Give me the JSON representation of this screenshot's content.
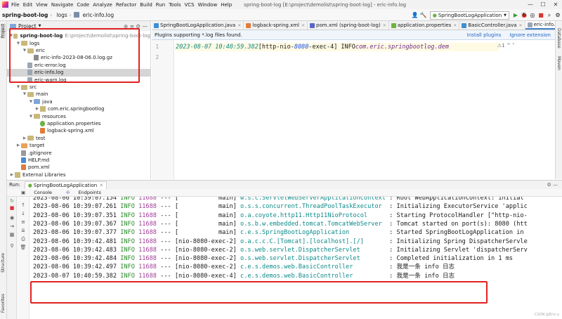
{
  "menu": {
    "items": [
      "File",
      "Edit",
      "View",
      "Navigate",
      "Code",
      "Analyze",
      "Refactor",
      "Build",
      "Run",
      "Tools",
      "VCS",
      "Window",
      "Help"
    ],
    "window_title": "spring-boot-log [E:\\project\\demolist\\spring-boot-log] - eric-info.log"
  },
  "nav": {
    "crumbs": [
      "spring-boot-log",
      "logs",
      "eric-info.log"
    ],
    "run_config": "SpringBootLogApplication"
  },
  "stripes": {
    "left": [
      "Project",
      "Structure",
      "Favorites"
    ],
    "right": [
      "Database",
      "Maven"
    ]
  },
  "project": {
    "header": "Project",
    "tree": [
      {
        "label": "spring-boot-log",
        "extra": "E:\\project\\demolist\\spring-boot-log",
        "indent": 0,
        "arrow": "v",
        "icon": "fold",
        "bold": true
      },
      {
        "label": "logs",
        "indent": 1,
        "arrow": "v",
        "icon": "fold"
      },
      {
        "label": "eric",
        "indent": 2,
        "arrow": "v",
        "icon": "fold"
      },
      {
        "label": "eric-info-2023-08-06.0.log.gz",
        "indent": 3,
        "arrow": "",
        "icon": "gz"
      },
      {
        "label": "eric-error.log",
        "indent": 2,
        "arrow": "",
        "icon": "file"
      },
      {
        "label": "eric-info.log",
        "indent": 2,
        "arrow": "",
        "icon": "file",
        "selected": true
      },
      {
        "label": "eric-warn.log",
        "indent": 2,
        "arrow": "",
        "icon": "file"
      },
      {
        "label": "src",
        "indent": 1,
        "arrow": "v",
        "icon": "fold"
      },
      {
        "label": "main",
        "indent": 2,
        "arrow": "v",
        "icon": "fold"
      },
      {
        "label": "java",
        "indent": 3,
        "arrow": "v",
        "icon": "blue"
      },
      {
        "label": "com.eric.springbootlog",
        "indent": 4,
        "arrow": ">",
        "icon": "pkg"
      },
      {
        "label": "resources",
        "indent": 3,
        "arrow": "v",
        "icon": "fold"
      },
      {
        "label": "application.properties",
        "indent": 4,
        "arrow": "",
        "icon": "spring"
      },
      {
        "label": "logback-spring.xml",
        "indent": 4,
        "arrow": "",
        "icon": "xml"
      },
      {
        "label": "test",
        "indent": 2,
        "arrow": ">",
        "icon": "fold"
      },
      {
        "label": "target",
        "indent": 1,
        "arrow": ">",
        "icon": "orange"
      },
      {
        "label": ".gitignore",
        "indent": 1,
        "arrow": "",
        "icon": "git"
      },
      {
        "label": "HELP.md",
        "indent": 1,
        "arrow": "",
        "icon": "md"
      },
      {
        "label": "pom.xml",
        "indent": 1,
        "arrow": "",
        "icon": "xml"
      },
      {
        "label": "External Libraries",
        "indent": 0,
        "arrow": ">",
        "icon": "pkg"
      }
    ]
  },
  "editor": {
    "tabs": [
      {
        "label": "SpringBootLogApplication.java",
        "color": "#3f8fd2"
      },
      {
        "label": "logback-spring.xml",
        "color": "#e07b3c"
      },
      {
        "label": "pom.xml (spring-boot-log)",
        "color": "#5865c9"
      },
      {
        "label": "application.properties",
        "color": "#6db33f"
      },
      {
        "label": "BasicController.java",
        "color": "#3f8fd2"
      },
      {
        "label": "eric-info.log",
        "color": "#9aa7b4",
        "active": true
      }
    ],
    "notice": "Plugins supporting *.log files found.",
    "notice_install": "Install plugins",
    "notice_ignore": "Ignore extension",
    "line_numbers": [
      "1",
      "2"
    ],
    "line1": {
      "ts": "2023-08-07 10:40:59.382",
      "thread_pre": " [http-nio-",
      "port": "8080",
      "thread_post": "-exec-4] INFO  ",
      "cls": "com.eric.springbootlog.dem"
    },
    "meta": "⚠1 ^ ˅"
  },
  "run": {
    "label": "Run:",
    "tab": "SpringBootLogApplication",
    "subtabs": [
      "Console",
      "Endpoints"
    ],
    "lines": [
      {
        "ts": "2023-08-06 10:39:07.154",
        "thread": "[           main]",
        "logger": "w.s.c.ServletWebServerApplicationContext",
        "msg": ": Root WebApplicationContext: initial"
      },
      {
        "ts": "2023-08-06 10:39:07.261",
        "thread": "[           main]",
        "logger": "o.s.s.concurrent.ThreadPoolTaskExecutor ",
        "msg": ": Initializing ExecutorService 'applic"
      },
      {
        "ts": "2023-08-06 10:39:07.351",
        "thread": "[           main]",
        "logger": "o.a.coyote.http11.Http11NioProtocol     ",
        "msg": ": Starting ProtocolHandler [\"http-nio-"
      },
      {
        "ts": "2023-08-06 10:39:07.367",
        "thread": "[           main]",
        "logger": "o.s.b.w.embedded.tomcat.TomcatWebServer ",
        "msg": ": Tomcat started on port(s): 8080 (htt"
      },
      {
        "ts": "2023-08-06 10:39:07.377",
        "thread": "[           main]",
        "logger": "c.e.s.SpringBootLogApplication          ",
        "msg": ": Started SpringBootLogApplication in "
      },
      {
        "ts": "2023-08-06 10:39:42.481",
        "thread": "[nio-8080-exec-2]",
        "logger": "o.a.c.c.C.[Tomcat].[localhost].[/]      ",
        "msg": ": Initializing Spring DispatcherServle"
      },
      {
        "ts": "2023-08-06 10:39:42.483",
        "thread": "[nio-8080-exec-2]",
        "logger": "o.s.web.servlet.DispatcherServlet       ",
        "msg": ": Initializing Servlet 'dispatcherServ"
      },
      {
        "ts": "2023-08-06 10:39:42.484",
        "thread": "[nio-8080-exec-2]",
        "logger": "o.s.web.servlet.DispatcherServlet       ",
        "msg": ": Completed initialization in 1 ms"
      },
      {
        "ts": "2023-08-06 10:39:42.497",
        "thread": "[nio-8080-exec-2]",
        "logger": "c.e.s.demos.web.BasicController         ",
        "msg": ": 我是一条 info 日志"
      },
      {
        "ts": "2023-08-07 10:40:59.382",
        "thread": "[nio-8080-exec-4]",
        "logger": "c.e.s.demos.web.BasicController         ",
        "msg": ": 我是一条 info 日志"
      }
    ],
    "level": "INFO",
    "pid": "11688",
    "dashes": "---",
    "watermark": "CSDN @Eric-x"
  },
  "colors": {
    "accent": "#4083c9",
    "highlight": "#e12121",
    "timestamp": "#0a8a8a",
    "level": "#2b8a2b",
    "pid": "#a03d96"
  }
}
